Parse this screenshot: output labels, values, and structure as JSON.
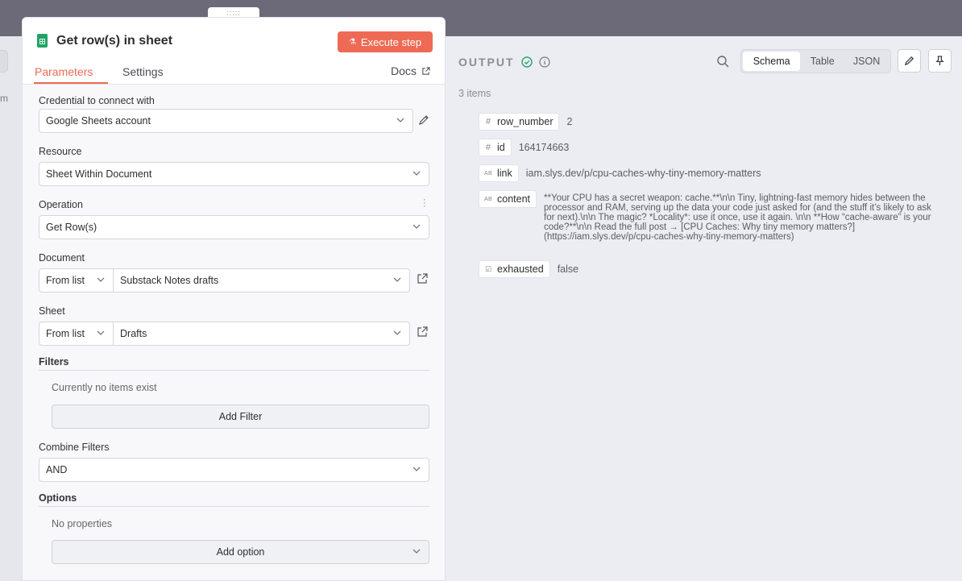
{
  "panel": {
    "drag_handle": ":::::",
    "title": "Get row(s) in sheet",
    "execute_label": "Execute step",
    "tabs": [
      "Parameters",
      "Settings"
    ],
    "docs_label": "Docs",
    "credential": {
      "label": "Credential to connect with",
      "value": "Google Sheets account"
    },
    "resource": {
      "label": "Resource",
      "value": "Sheet Within Document"
    },
    "operation": {
      "label": "Operation",
      "value": "Get Row(s)"
    },
    "document": {
      "label": "Document",
      "mode": "From list",
      "value": "Substack Notes drafts"
    },
    "sheet": {
      "label": "Sheet",
      "mode": "From list",
      "value": "Drafts"
    },
    "filters": {
      "label": "Filters",
      "empty": "Currently no items exist",
      "add_label": "Add Filter"
    },
    "combine": {
      "label": "Combine Filters",
      "value": "AND"
    },
    "options": {
      "label": "Options",
      "empty": "No properties",
      "add_label": "Add option"
    }
  },
  "output": {
    "title": "OUTPUT",
    "count": "3 items",
    "views": [
      "Schema",
      "Table",
      "JSON"
    ],
    "fields": [
      {
        "icon": "#",
        "name": "row_number",
        "value": "2"
      },
      {
        "icon": "#",
        "name": "id",
        "value": "164174663"
      },
      {
        "icon": "AB",
        "name": "link",
        "value": "iam.slys.dev/p/cpu-caches-why-tiny-memory-matters"
      },
      {
        "icon": "AB",
        "name": "content",
        "value": "**Your CPU has a secret weapon: cache.**\\n\\n Tiny, lightning-fast memory hides between the processor and RAM, serving up the data your code just asked for (and the stuff it’s likely to ask for next).\\n\\n The magic? *Locality*: use it once, use it again. \\n\\n **How “cache-aware” is your code?**\\n\\n Read the full post → [CPU Caches: Why tiny memory matters?](https://iam.slys.dev/p/cpu-caches-why-tiny-memory-matters)"
      },
      {
        "icon": "☑",
        "name": "exhausted",
        "value": "false"
      }
    ]
  },
  "left_strip": {
    "fragment": "m"
  },
  "colors": {
    "accent": "#ee6a55",
    "success": "#29a36a",
    "sheets_green": "#20a464"
  }
}
